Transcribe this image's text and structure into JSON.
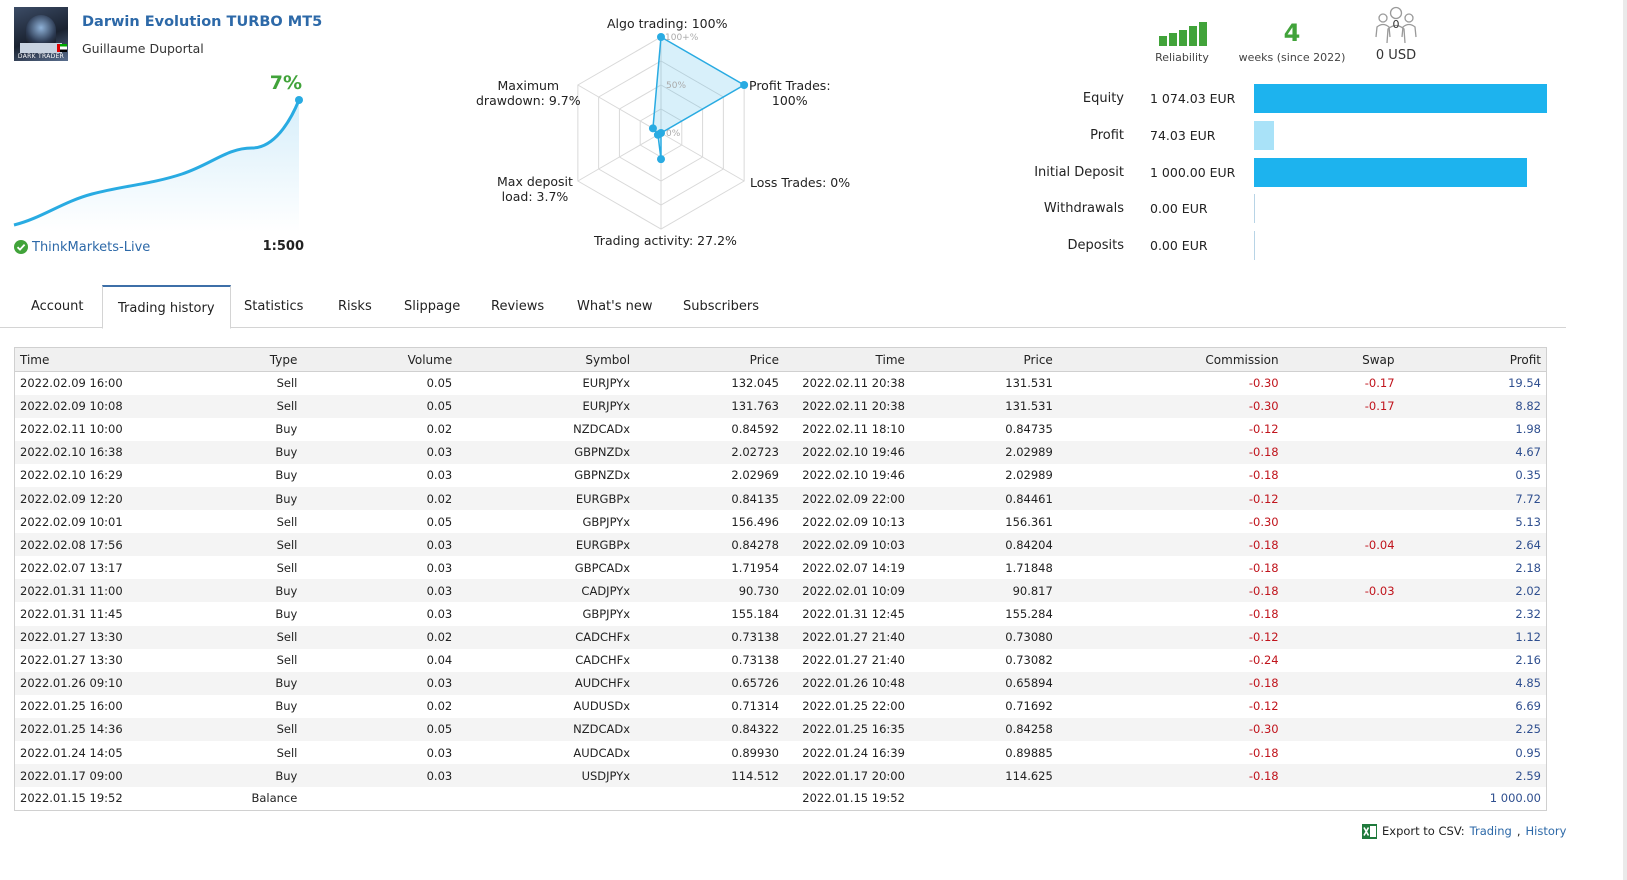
{
  "header": {
    "robot_name": "Darwin Evolution TURBO MT5",
    "author": "Guillaume Duportal",
    "avatar_caption": "DARK TRADER",
    "avatar_flag": "uae-flag",
    "growth": "7%",
    "broker": "ThinkMarkets-Live",
    "broker_icon": "verified-check-icon",
    "leverage": "1:500"
  },
  "growth_chart": {
    "type": "area",
    "color": "#29abe2",
    "marker_color": "#29abe2"
  },
  "radar": {
    "labels": {
      "algo": "Algo trading: 100%",
      "profit_trades": "Profit Trades: 100%",
      "profit_trades_l1": "Profit Trades:",
      "profit_trades_l2": "100%",
      "loss_trades": "Loss Trades: 0%",
      "activity": "Trading activity: 27.2%",
      "deposit_load_l1": "Max deposit",
      "deposit_load_l2": "load: 3.7%",
      "drawdown_l1": "Maximum",
      "drawdown_l2": "drawdown: 9.7%"
    },
    "scale_labels": [
      "100+%",
      "50%",
      "0%"
    ]
  },
  "chart_data": {
    "type": "radar",
    "axes": [
      "Algo trading",
      "Profit Trades",
      "Loss Trades",
      "Trading activity",
      "Max deposit load",
      "Maximum drawdown"
    ],
    "values": [
      100,
      100,
      0,
      27.2,
      3.7,
      9.7
    ],
    "range": [
      0,
      100
    ],
    "color": "#29abe2"
  },
  "stats": {
    "reliability_label": "Reliability",
    "reliability_icon": "signal-bars-icon",
    "weeks_value": "4",
    "weeks_label": "weeks (since 2022)",
    "subscribers_count": "0",
    "subscribers_icon": "subscribers-icon",
    "subscribers_value": "0 USD"
  },
  "balance": {
    "bar_color": "#1db3ee",
    "bar_color_light": "#a9e2f8",
    "rows": [
      {
        "label": "Equity",
        "value": "1 074.03 EUR",
        "amount": 1074.03
      },
      {
        "label": "Profit",
        "value": "74.03 EUR",
        "amount": 74.03
      },
      {
        "label": "Initial Deposit",
        "value": "1 000.00 EUR",
        "amount": 1000.0
      },
      {
        "label": "Withdrawals",
        "value": "0.00 EUR",
        "amount": 0
      },
      {
        "label": "Deposits",
        "value": "0.00 EUR",
        "amount": 0
      }
    ]
  },
  "tabs": [
    "Account",
    "Trading history",
    "Statistics",
    "Risks",
    "Slippage",
    "Reviews",
    "What's new",
    "Subscribers"
  ],
  "active_tab": 1,
  "table": {
    "headers": [
      "Time",
      "Type",
      "Volume",
      "Symbol",
      "Price",
      "Time",
      "Price",
      "Commission",
      "Swap",
      "Profit"
    ],
    "rows": [
      [
        "2022.02.09 16:00",
        "Sell",
        "0.05",
        "EURJPYx",
        "132.045",
        "2022.02.11 20:38",
        "131.531",
        "-0.30",
        "-0.17",
        "19.54"
      ],
      [
        "2022.02.09 10:08",
        "Sell",
        "0.05",
        "EURJPYx",
        "131.763",
        "2022.02.11 20:38",
        "131.531",
        "-0.30",
        "-0.17",
        "8.82"
      ],
      [
        "2022.02.11 10:00",
        "Buy",
        "0.02",
        "NZDCADx",
        "0.84592",
        "2022.02.11 18:10",
        "0.84735",
        "-0.12",
        "",
        "1.98"
      ],
      [
        "2022.02.10 16:38",
        "Buy",
        "0.03",
        "GBPNZDx",
        "2.02723",
        "2022.02.10 19:46",
        "2.02989",
        "-0.18",
        "",
        "4.67"
      ],
      [
        "2022.02.10 16:29",
        "Buy",
        "0.03",
        "GBPNZDx",
        "2.02969",
        "2022.02.10 19:46",
        "2.02989",
        "-0.18",
        "",
        "0.35"
      ],
      [
        "2022.02.09 12:20",
        "Buy",
        "0.02",
        "EURGBPx",
        "0.84135",
        "2022.02.09 22:00",
        "0.84461",
        "-0.12",
        "",
        "7.72"
      ],
      [
        "2022.02.09 10:01",
        "Sell",
        "0.05",
        "GBPJPYx",
        "156.496",
        "2022.02.09 10:13",
        "156.361",
        "-0.30",
        "",
        "5.13"
      ],
      [
        "2022.02.08 17:56",
        "Sell",
        "0.03",
        "EURGBPx",
        "0.84278",
        "2022.02.09 10:03",
        "0.84204",
        "-0.18",
        "-0.04",
        "2.64"
      ],
      [
        "2022.02.07 13:17",
        "Sell",
        "0.03",
        "GBPCADx",
        "1.71954",
        "2022.02.07 14:19",
        "1.71848",
        "-0.18",
        "",
        "2.18"
      ],
      [
        "2022.01.31 11:00",
        "Buy",
        "0.03",
        "CADJPYx",
        "90.730",
        "2022.02.01 10:09",
        "90.817",
        "-0.18",
        "-0.03",
        "2.02"
      ],
      [
        "2022.01.31 11:45",
        "Buy",
        "0.03",
        "GBPJPYx",
        "155.184",
        "2022.01.31 12:45",
        "155.284",
        "-0.18",
        "",
        "2.32"
      ],
      [
        "2022.01.27 13:30",
        "Sell",
        "0.02",
        "CADCHFx",
        "0.73138",
        "2022.01.27 21:40",
        "0.73080",
        "-0.12",
        "",
        "1.12"
      ],
      [
        "2022.01.27 13:30",
        "Sell",
        "0.04",
        "CADCHFx",
        "0.73138",
        "2022.01.27 21:40",
        "0.73082",
        "-0.24",
        "",
        "2.16"
      ],
      [
        "2022.01.26 09:10",
        "Buy",
        "0.03",
        "AUDCHFx",
        "0.65726",
        "2022.01.26 10:48",
        "0.65894",
        "-0.18",
        "",
        "4.85"
      ],
      [
        "2022.01.25 16:00",
        "Buy",
        "0.02",
        "AUDUSDx",
        "0.71314",
        "2022.01.25 22:00",
        "0.71692",
        "-0.12",
        "",
        "6.69"
      ],
      [
        "2022.01.25 14:36",
        "Sell",
        "0.05",
        "NZDCADx",
        "0.84322",
        "2022.01.25 16:35",
        "0.84258",
        "-0.30",
        "",
        "2.25"
      ],
      [
        "2022.01.24 14:05",
        "Sell",
        "0.03",
        "AUDCADx",
        "0.89930",
        "2022.01.24 16:39",
        "0.89885",
        "-0.18",
        "",
        "0.95"
      ],
      [
        "2022.01.17 09:00",
        "Buy",
        "0.03",
        "USDJPYx",
        "114.512",
        "2022.01.17 20:00",
        "114.625",
        "-0.18",
        "",
        "2.59"
      ],
      [
        "2022.01.15 19:52",
        "Balance",
        "",
        "",
        "",
        "2022.01.15 19:52",
        "",
        "",
        "",
        "1 000.00"
      ]
    ]
  },
  "export": {
    "icon": "excel-icon",
    "label": "Export to CSV:",
    "link_trading": "Trading",
    "separator": ",",
    "link_history": "History"
  }
}
